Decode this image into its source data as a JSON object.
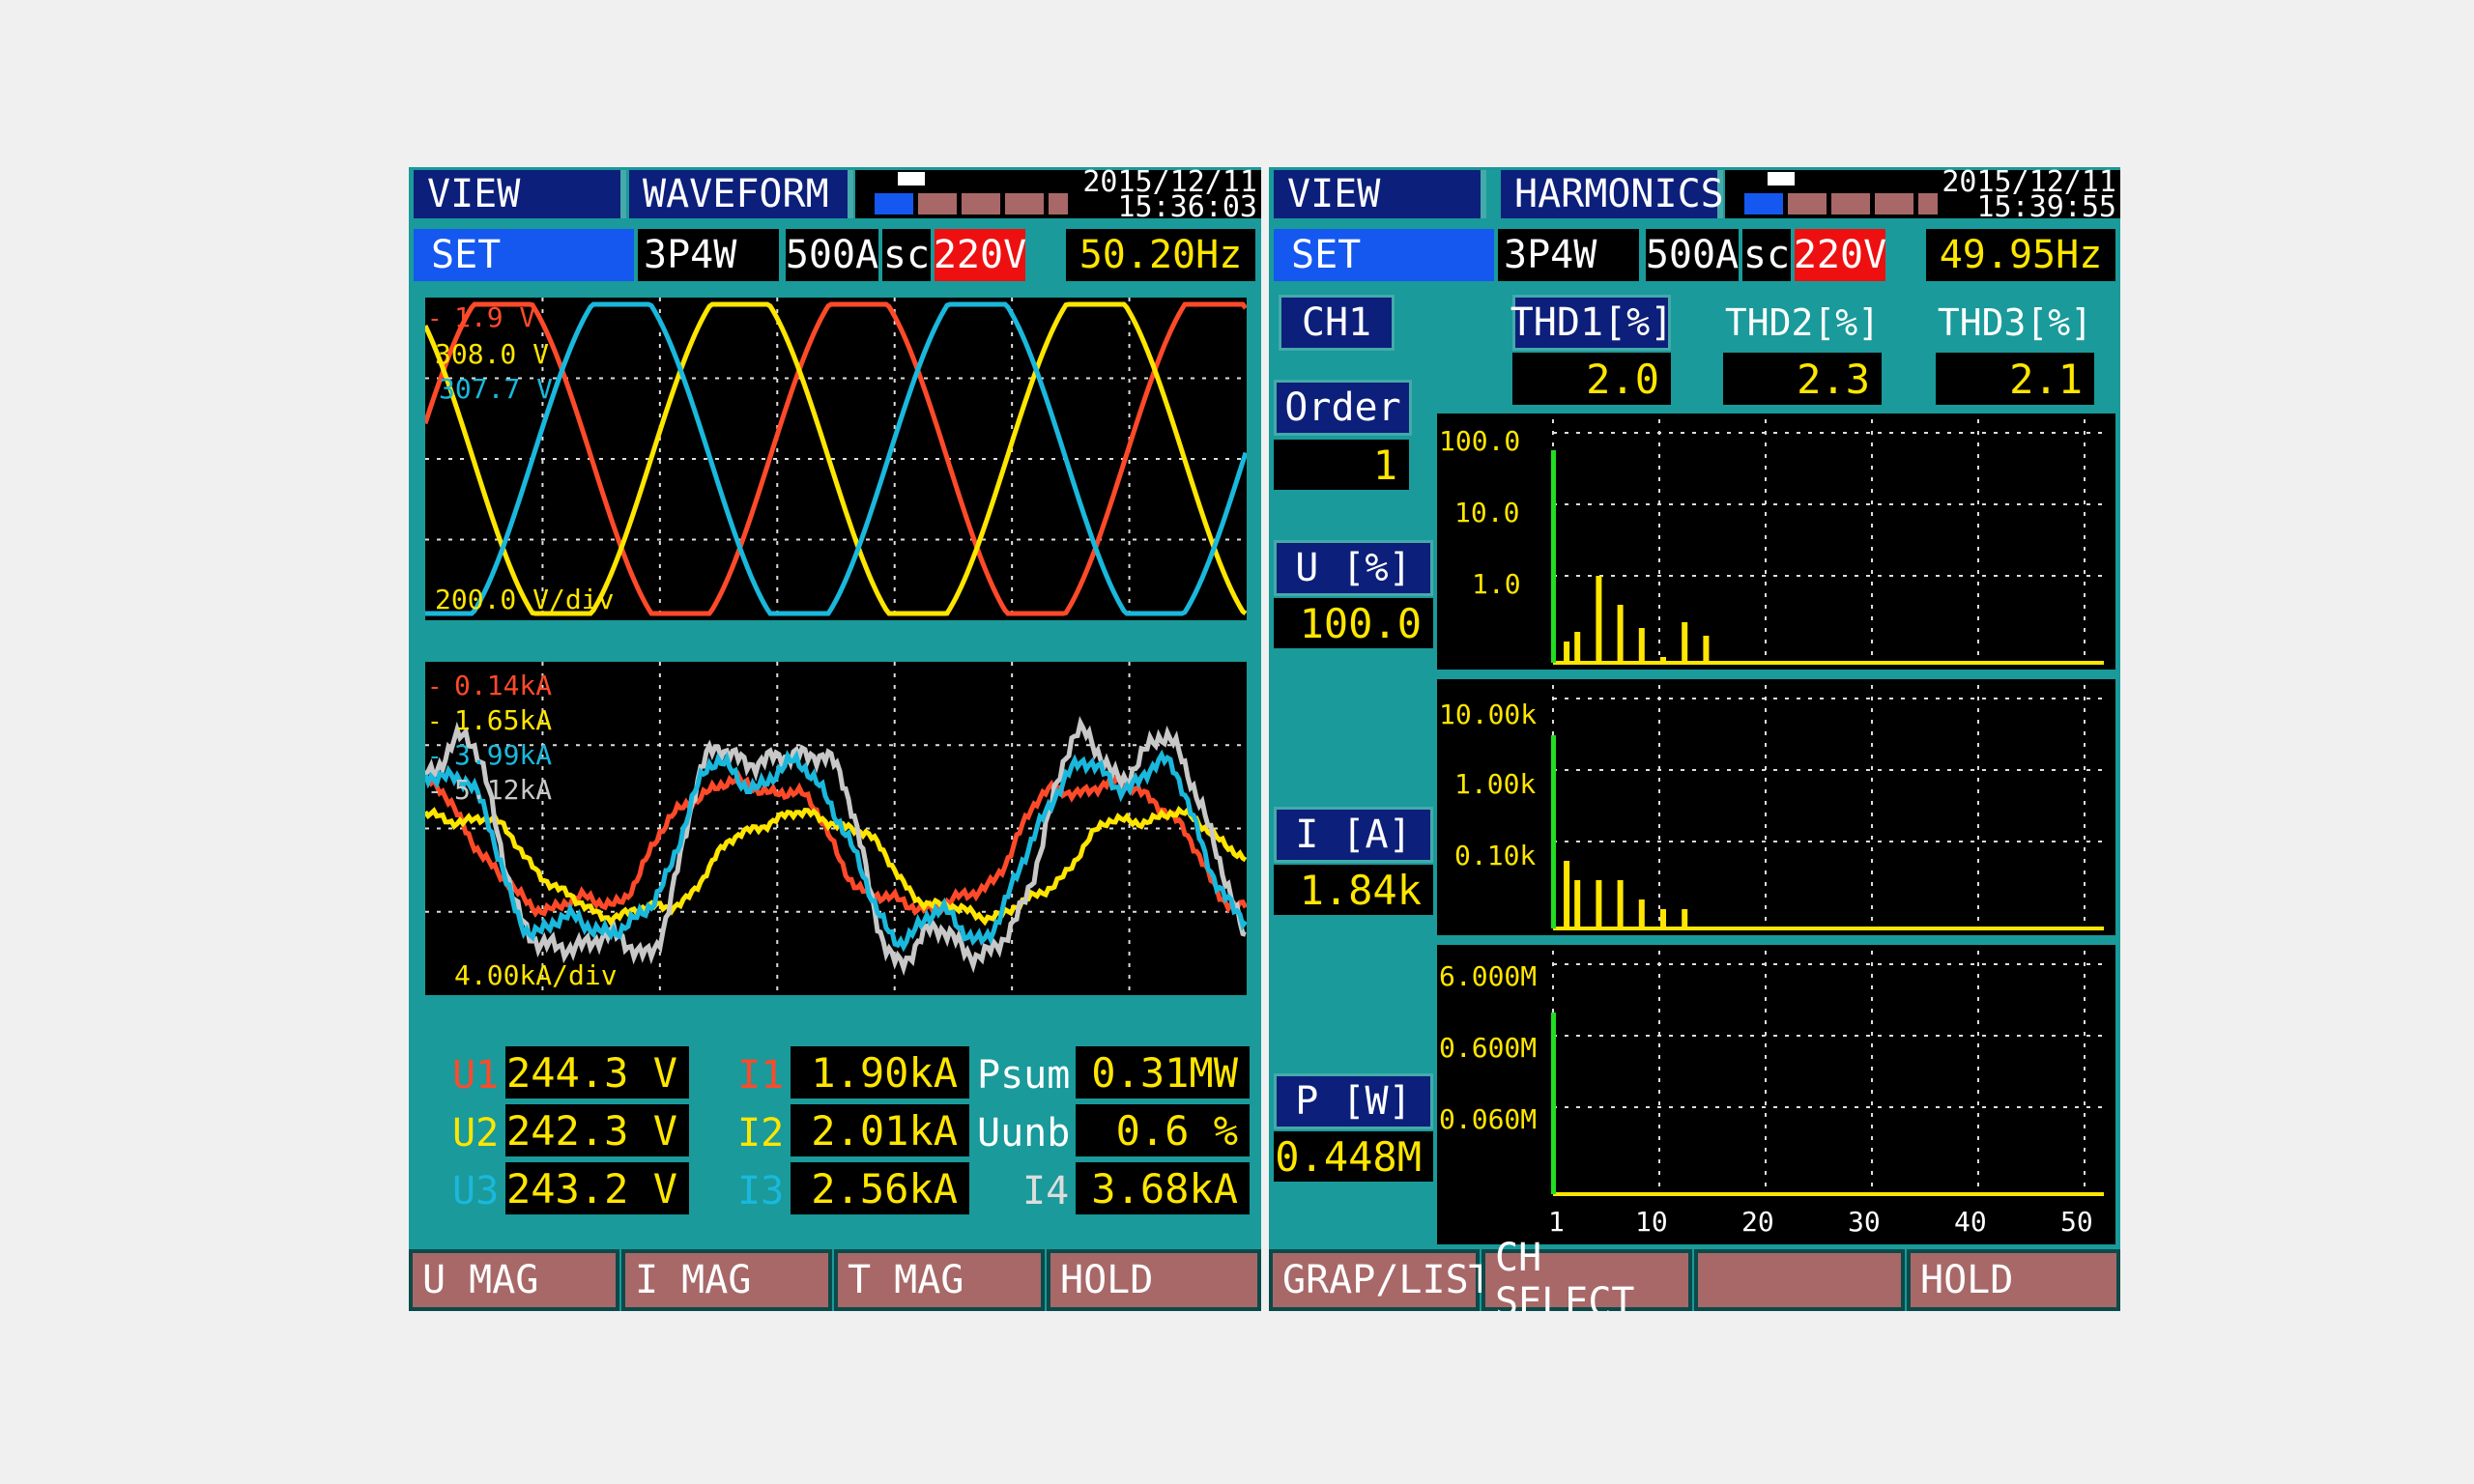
{
  "left": {
    "header": {
      "view": "VIEW",
      "mode": "WAVEFORM",
      "date": "2015/12/11",
      "time": "15:36:03"
    },
    "setbar": {
      "set": "SET",
      "wiring": "3P4W",
      "range_i": "500A",
      "sc": "sc",
      "voltage": "220V",
      "freq": "50.20Hz"
    },
    "voltage_plot": {
      "labels": [
        {
          "text": "1.9 V",
          "color": "#ff4a2a"
        },
        {
          "text": "308.0 V",
          "color": "#ffe600"
        },
        {
          "text": "307.7 V",
          "color": "#1ab8dc"
        }
      ],
      "scale": "200.0 V/div"
    },
    "current_plot": {
      "labels": [
        {
          "text": "0.14kA",
          "color": "#ff4a2a"
        },
        {
          "text": "1.65kA",
          "color": "#ffe600"
        },
        {
          "text": "3.99kA",
          "color": "#1ab8dc"
        },
        {
          "text": "5.12kA",
          "color": "#c8c8c8"
        }
      ],
      "scale": "4.00kA/div"
    },
    "readings": [
      [
        {
          "label": "U1",
          "value": "244.3 V",
          "label_color": "#ff4a2a"
        },
        {
          "label": "I1",
          "value": "1.90kA",
          "label_color": "#ff4a2a"
        },
        {
          "label": "Psum",
          "value": "0.31MW",
          "label_color": "#ffffff"
        }
      ],
      [
        {
          "label": "U2",
          "value": "242.3 V",
          "label_color": "#ffe600"
        },
        {
          "label": "I2",
          "value": "2.01kA",
          "label_color": "#ffe600"
        },
        {
          "label": "Uunb",
          "value": "0.6 %",
          "label_color": "#ffffff"
        }
      ],
      [
        {
          "label": "U3",
          "value": "243.2 V",
          "label_color": "#1ab8dc"
        },
        {
          "label": "I3",
          "value": "2.56kA",
          "label_color": "#1ab8dc"
        },
        {
          "label": "I4",
          "value": "3.68kA",
          "label_color": "#dddddd"
        }
      ]
    ],
    "fkeys": [
      "U MAG",
      "I MAG",
      "T MAG",
      "HOLD"
    ]
  },
  "right": {
    "header": {
      "view": "VIEW",
      "mode": "HARMONICS",
      "date": "2015/12/11",
      "time": "15:39:55"
    },
    "setbar": {
      "set": "SET",
      "wiring": "3P4W",
      "range_i": "500A",
      "sc": "sc",
      "voltage": "220V",
      "freq": "49.95Hz"
    },
    "channel": "CH1",
    "thd": [
      {
        "label": "THD1[%]",
        "value": "2.0"
      },
      {
        "label": "THD2[%]",
        "value": "2.3"
      },
      {
        "label": "THD3[%]",
        "value": "2.1"
      }
    ],
    "order": {
      "label": "Order",
      "value": "1"
    },
    "u": {
      "label": "U [%]",
      "value": "100.0"
    },
    "i": {
      "label": "I [A]",
      "value": "1.84k"
    },
    "p": {
      "label": "P [W]",
      "value": "0.448M"
    },
    "u_plot_ticks": [
      "100.0",
      "10.0",
      "1.0"
    ],
    "i_plot_ticks": [
      "10.00k",
      "1.00k",
      "0.10k"
    ],
    "p_plot_ticks": [
      "6.000M",
      "0.600M",
      "0.060M"
    ],
    "x_ticks": [
      "1",
      "10",
      "20",
      "30",
      "40",
      "50"
    ],
    "fkeys": [
      "GRAP/LIST",
      "CH SELECT",
      "",
      "HOLD"
    ]
  },
  "colors": {
    "screen": "#1a9a9a",
    "plot_bg": "#000000",
    "red": "#ff4a2a",
    "yellow": "#ffe600",
    "cyan": "#1ab8dc",
    "grey": "#c8c8c8",
    "green": "#22dd22",
    "navy": "#0c1f7a",
    "blue": "#1558f0",
    "fkey": "#a86868"
  }
}
